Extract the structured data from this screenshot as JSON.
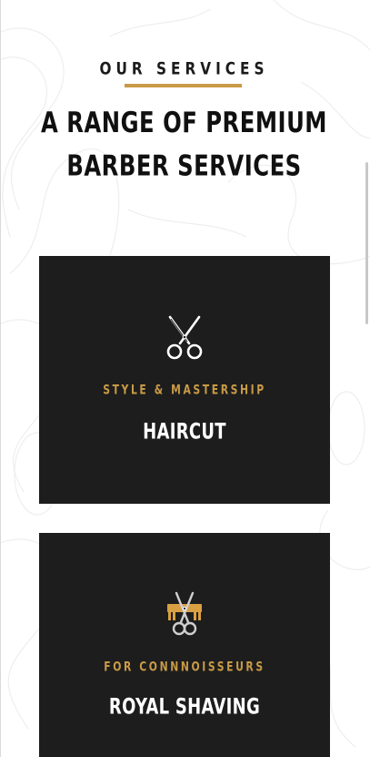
{
  "services_section": {
    "eyebrow": "OUR SERVICES",
    "headline_line1": "A RANGE OF PREMIUM",
    "headline_line2": "BARBER SERVICES",
    "accent_color": "#c99a46",
    "card_background": "#1d1d1d"
  },
  "cards": [
    {
      "icon": "scissors-icon",
      "subtitle": "STYLE & MASTERSHIP",
      "title": "HAIRCUT"
    },
    {
      "icon": "scissors-comb-icon",
      "subtitle": "FOR CONNNOISSEURS",
      "title": "ROYAL SHAVING"
    }
  ]
}
